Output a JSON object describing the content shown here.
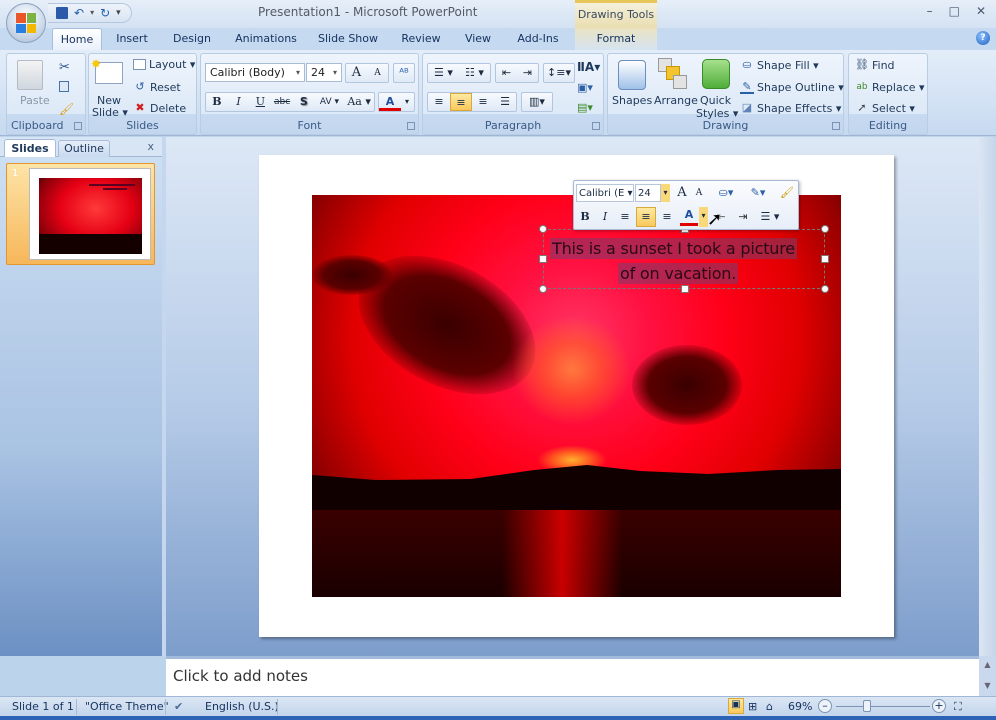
{
  "window": {
    "title": "Presentation1 - Microsoft PowerPoint",
    "context_tab_group": "Drawing Tools",
    "controls": {
      "minimize": "–",
      "maximize": "□",
      "close": "✕"
    }
  },
  "quick_access": {
    "save": "save-icon",
    "undo": "undo-icon",
    "redo": "redo-icon",
    "customize": "▾"
  },
  "tabs": [
    {
      "label": "Home",
      "active": true
    },
    {
      "label": "Insert"
    },
    {
      "label": "Design"
    },
    {
      "label": "Animations"
    },
    {
      "label": "Slide Show"
    },
    {
      "label": "Review"
    },
    {
      "label": "View"
    },
    {
      "label": "Add-Ins"
    },
    {
      "label": "Format",
      "contextual": true
    }
  ],
  "ribbon": {
    "clipboard": {
      "label": "Clipboard",
      "paste": "Paste"
    },
    "slides": {
      "label": "Slides",
      "new_slide_1": "New",
      "new_slide_2": "Slide ▾",
      "layout": "Layout ▾",
      "reset": "Reset",
      "delete": "Delete"
    },
    "font": {
      "label": "Font",
      "font_name": "Calibri (Body)",
      "font_size": "24",
      "bold": "B",
      "italic": "I",
      "underline": "U",
      "strike": "abc",
      "shadow": "S",
      "spacing": "AV",
      "case": "Aa",
      "color": "A",
      "grow": "A",
      "shrink": "A"
    },
    "paragraph": {
      "label": "Paragraph"
    },
    "drawing": {
      "label": "Drawing",
      "shapes": "Shapes",
      "arrange": "Arrange",
      "quick_styles_1": "Quick",
      "quick_styles_2": "Styles ▾",
      "shape_fill": "Shape Fill ▾",
      "shape_outline": "Shape Outline ▾",
      "shape_effects": "Shape Effects ▾"
    },
    "editing": {
      "label": "Editing",
      "find": "Find",
      "replace": "Replace ▾",
      "select": "Select ▾"
    }
  },
  "left_pane": {
    "tabs": [
      {
        "label": "Slides",
        "active": true
      },
      {
        "label": "Outline"
      }
    ],
    "close": "x",
    "slides": [
      {
        "number": "1"
      }
    ]
  },
  "slide": {
    "textbox_lines": [
      "This is a sunset I took a picture",
      "of on vacation."
    ]
  },
  "mini_toolbar": {
    "font_name": "Calibri (E ▾",
    "font_size": "24",
    "bold": "B",
    "italic": "I",
    "font_color": "A"
  },
  "notes": {
    "placeholder": "Click to add notes"
  },
  "status": {
    "slide_indicator": "Slide 1 of 1",
    "theme": "\"Office Theme\"",
    "language": "English (U.S.)",
    "zoom": "69%",
    "zoom_percent": 69
  },
  "colors": {
    "ribbon_bg": "#d0e0f3",
    "active_highlight": "#f8c95c",
    "context_tab": "#e8c75a",
    "font_color_bar": "#e00000"
  }
}
